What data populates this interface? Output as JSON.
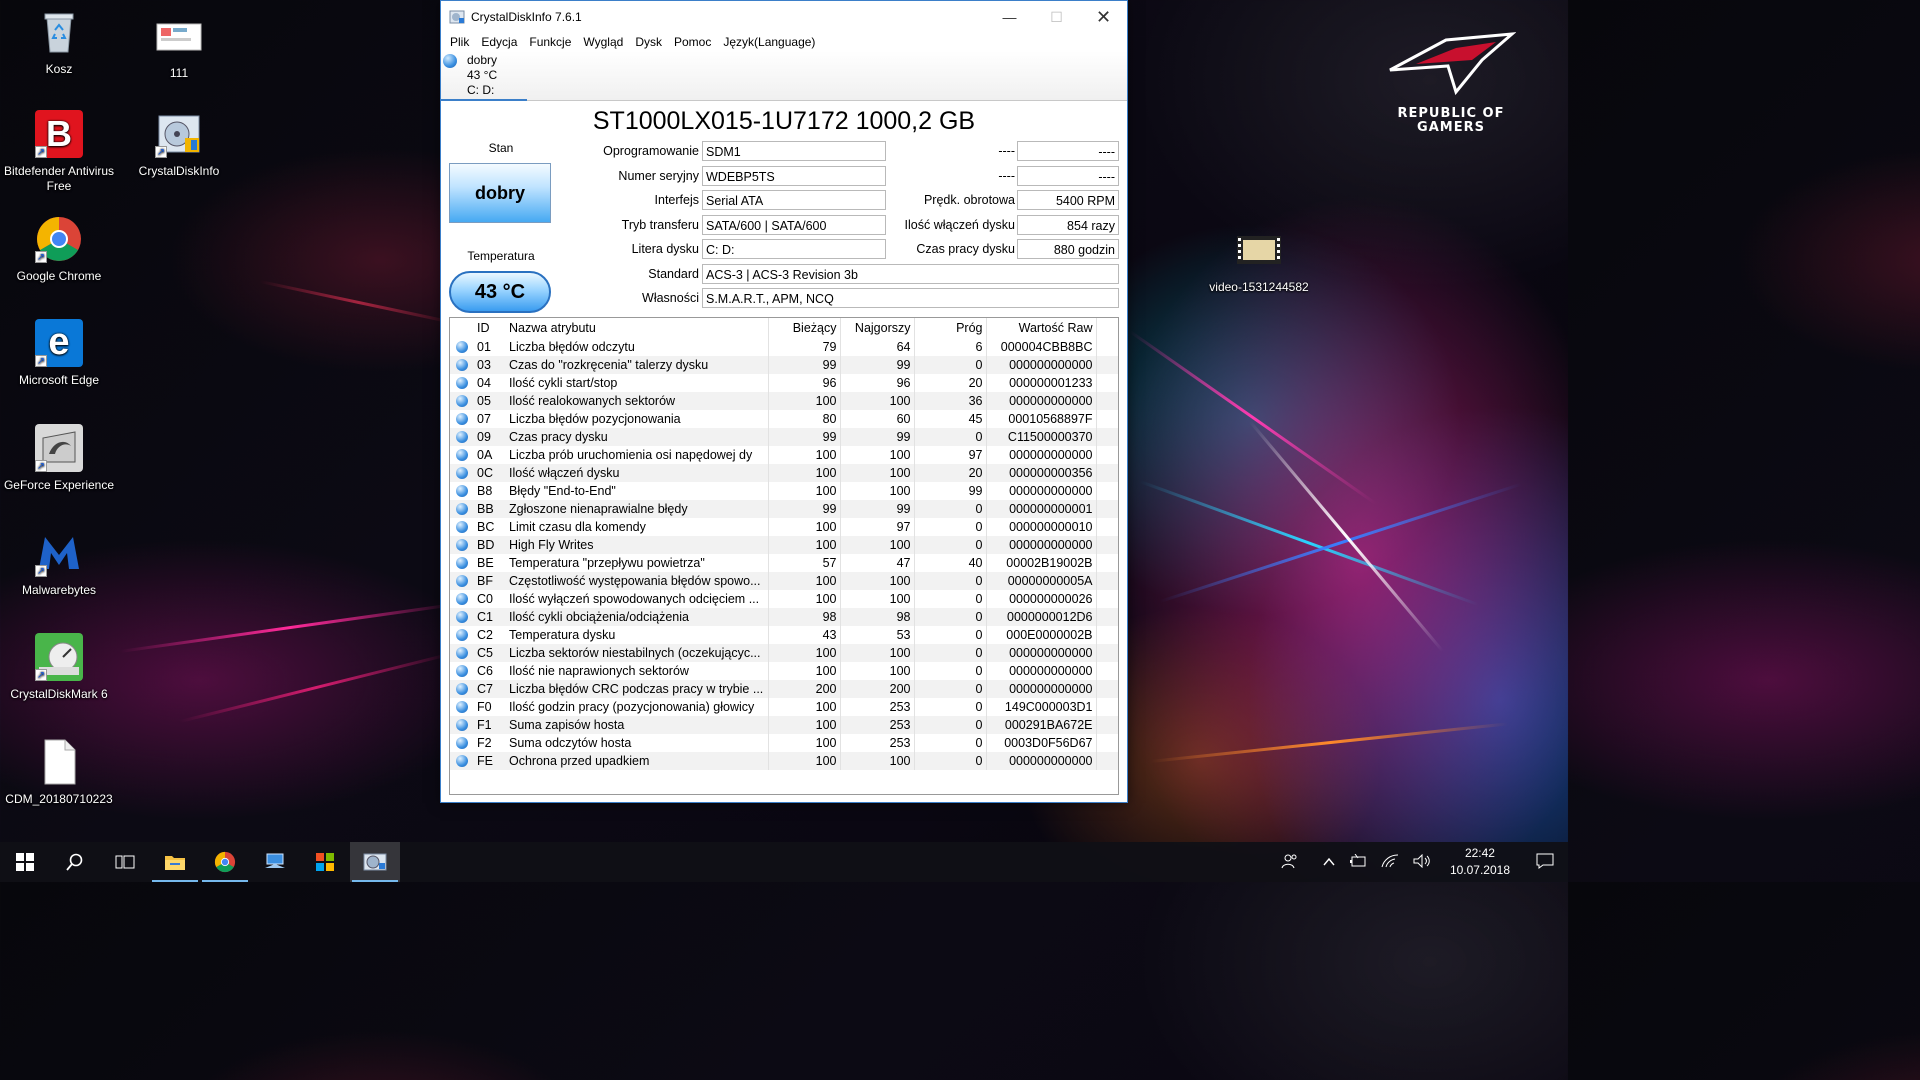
{
  "desktop": {
    "icons": [
      {
        "label": "Kosz",
        "icon": "recycle-bin-icon"
      },
      {
        "label": "111",
        "icon": "image-file-icon"
      },
      {
        "label": "Bitdefender Antivirus Free",
        "icon": "bitdefender-icon"
      },
      {
        "label": "CrystalDiskInfo",
        "icon": "crystaldiskinfo-icon"
      },
      {
        "label": "Google Chrome",
        "icon": "chrome-icon"
      },
      {
        "label": "Microsoft Edge",
        "icon": "edge-icon"
      },
      {
        "label": "GeForce Experience",
        "icon": "geforce-icon"
      },
      {
        "label": "Malwarebytes",
        "icon": "malwarebytes-icon"
      },
      {
        "label": "CrystalDiskMark 6",
        "icon": "crystaldiskmark-icon"
      },
      {
        "label": "CDM_20180710223",
        "icon": "text-file-icon"
      },
      {
        "label": "video-1531244582",
        "icon": "video-file-icon"
      }
    ],
    "wallpaper_logo": "REPUBLIC OF GAMERS"
  },
  "window": {
    "title": "CrystalDiskInfo 7.6.1",
    "menu": [
      "Plik",
      "Edycja",
      "Funkcje",
      "Wygląd",
      "Dysk",
      "Pomoc",
      "Język(Language)"
    ],
    "drive_tab": {
      "status": "dobry",
      "temp": "43 °C",
      "letters": "C: D:"
    },
    "model": "ST1000LX015-1U7172 1000,2 GB",
    "health_label": "Stan",
    "health_value": "dobry",
    "temp_label": "Temperatura",
    "temp_value": "43 °C",
    "fields": {
      "firmware": {
        "label": "Oprogramowanie",
        "value": "SDM1"
      },
      "serial": {
        "label": "Numer seryjny",
        "value": "WDEBP5TS"
      },
      "interface": {
        "label": "Interfejs",
        "value": "Serial ATA"
      },
      "transfer": {
        "label": "Tryb transferu",
        "value": "SATA/600 | SATA/600"
      },
      "letter": {
        "label": "Litera dysku",
        "value": "C: D:"
      },
      "standard": {
        "label": "Standard",
        "value": "ACS-3 | ACS-3 Revision 3b"
      },
      "features": {
        "label": "Własności",
        "value": "S.M.A.R.T., APM, NCQ"
      },
      "blank1": {
        "label": "----",
        "value": "----"
      },
      "blank2": {
        "label": "----",
        "value": "----"
      },
      "rpm": {
        "label": "Prędk. obrotowa",
        "value": "5400 RPM"
      },
      "power_count": {
        "label": "Ilość włączeń dysku",
        "value": "854 razy"
      },
      "power_hours": {
        "label": "Czas pracy dysku",
        "value": "880 godzin"
      }
    },
    "smart": {
      "headers": [
        "",
        "ID",
        "Nazwa atrybutu",
        "Bieżący",
        "Najgorszy",
        "Próg",
        "Wartość Raw"
      ],
      "rows": [
        [
          "01",
          "Liczba błędów odczytu",
          "79",
          "64",
          "6",
          "000004CBB8BC"
        ],
        [
          "03",
          "Czas do \"rozkręcenia\" talerzy dysku",
          "99",
          "99",
          "0",
          "000000000000"
        ],
        [
          "04",
          "Ilość cykli start/stop",
          "96",
          "96",
          "20",
          "000000001233"
        ],
        [
          "05",
          "Ilość realokowanych sektorów",
          "100",
          "100",
          "36",
          "000000000000"
        ],
        [
          "07",
          "Liczba błędów pozycjonowania",
          "80",
          "60",
          "45",
          "00010568897F"
        ],
        [
          "09",
          "Czas pracy dysku",
          "99",
          "99",
          "0",
          "C11500000370"
        ],
        [
          "0A",
          "Liczba prób uruchomienia osi napędowej dy",
          "100",
          "100",
          "97",
          "000000000000"
        ],
        [
          "0C",
          "Ilość włączeń dysku",
          "100",
          "100",
          "20",
          "000000000356"
        ],
        [
          "B8",
          "Błędy \"End-to-End\"",
          "100",
          "100",
          "99",
          "000000000000"
        ],
        [
          "BB",
          "Zgłoszone nienaprawialne błędy",
          "99",
          "99",
          "0",
          "000000000001"
        ],
        [
          "BC",
          "Limit czasu dla komendy",
          "100",
          "97",
          "0",
          "000000000010"
        ],
        [
          "BD",
          "High Fly Writes",
          "100",
          "100",
          "0",
          "000000000000"
        ],
        [
          "BE",
          "Temperatura \"przepływu powietrza\"",
          "57",
          "47",
          "40",
          "00002B19002B"
        ],
        [
          "BF",
          "Częstotliwość występowania błędów spowo...",
          "100",
          "100",
          "0",
          "00000000005A"
        ],
        [
          "C0",
          "Ilość wyłączeń spowodowanych odcięciem ...",
          "100",
          "100",
          "0",
          "000000000026"
        ],
        [
          "C1",
          "Ilość cykli obciążenia/odciążenia",
          "98",
          "98",
          "0",
          "0000000012D6"
        ],
        [
          "C2",
          "Temperatura dysku",
          "43",
          "53",
          "0",
          "000E0000002B"
        ],
        [
          "C5",
          "Liczba sektorów niestabilnych (oczekującyc...",
          "100",
          "100",
          "0",
          "000000000000"
        ],
        [
          "C6",
          "Ilość nie naprawionych sektorów",
          "100",
          "100",
          "0",
          "000000000000"
        ],
        [
          "C7",
          "Liczba błędów CRC podczas pracy w trybie ...",
          "200",
          "200",
          "0",
          "000000000000"
        ],
        [
          "F0",
          "Ilość godzin pracy (pozycjonowania) głowicy",
          "100",
          "253",
          "0",
          "149C000003D1"
        ],
        [
          "F1",
          "Suma zapisów hosta",
          "100",
          "253",
          "0",
          "000291BA672E"
        ],
        [
          "F2",
          "Suma odczytów hosta",
          "100",
          "253",
          "0",
          "0003D0F56D67"
        ],
        [
          "FE",
          "Ochrona przed upadkiem",
          "100",
          "100",
          "0",
          "000000000000"
        ]
      ]
    }
  },
  "taskbar": {
    "clock_time": "22:42",
    "clock_date": "10.07.2018",
    "pinned": [
      "start-icon",
      "search-icon",
      "task-view-icon",
      "file-explorer-icon",
      "chrome-icon",
      "network-app-icon",
      "windows-app-icon",
      "crystaldiskinfo-icon"
    ]
  },
  "colors": {
    "accent": "#3b7fc9",
    "good": "#46a9f2"
  }
}
